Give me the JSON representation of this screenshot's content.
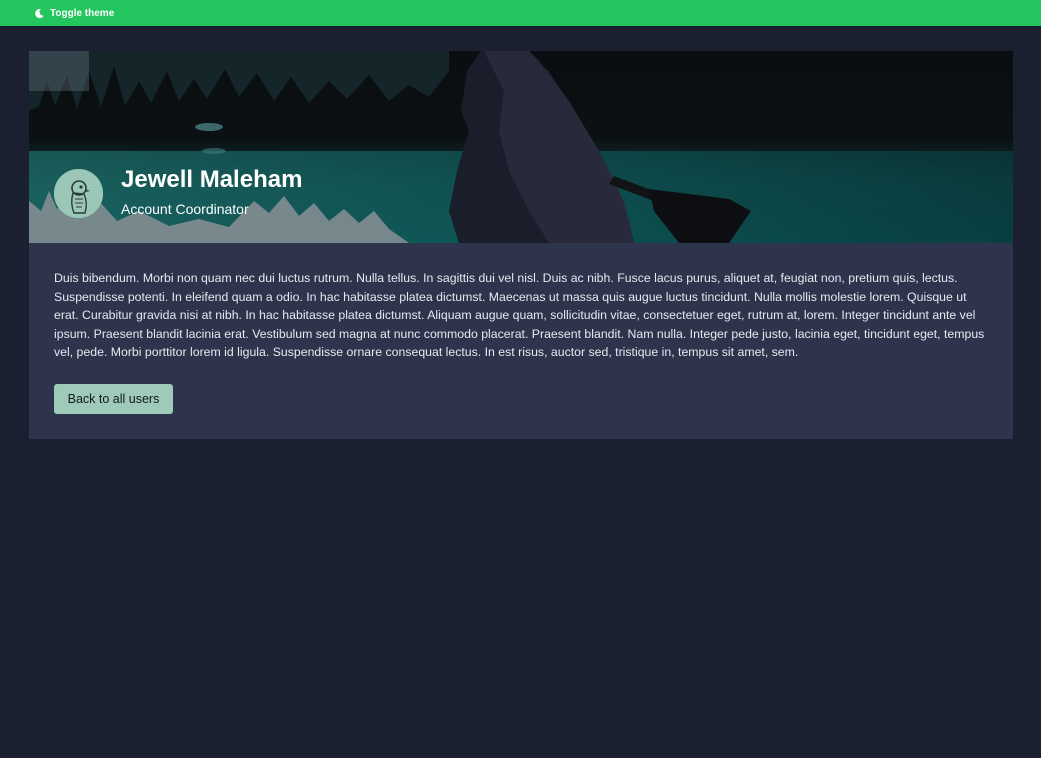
{
  "topbar": {
    "toggle_label": "Toggle theme",
    "bg_color": "#22c55e",
    "icon": "moon-icon"
  },
  "profile": {
    "name": "Jewell Maleham",
    "title": "Account Coordinator",
    "avatar_icon": "bird-avatar-icon",
    "bio": "Duis bibendum. Morbi non quam nec dui luctus rutrum. Nulla tellus. In sagittis dui vel nisl. Duis ac nibh. Fusce lacus purus, aliquet at, feugiat non, pretium quis, lectus. Suspendisse potenti. In eleifend quam a odio. In hac habitasse platea dictumst. Maecenas ut massa quis augue luctus tincidunt. Nulla mollis molestie lorem. Quisque ut erat. Curabitur gravida nisi at nibh. In hac habitasse platea dictumst. Aliquam augue quam, sollicitudin vitae, consectetuer eget, rutrum at, lorem. Integer tincidunt ante vel ipsum. Praesent blandit lacinia erat. Vestibulum sed magna at nunc commodo placerat. Praesent blandit. Nam nulla. Integer pede justo, lacinia eget, tincidunt eget, tempus vel, pede. Morbi porttitor lorem id ligula. Suspendisse ornare consequat lectus. In est risus, auctor sed, tristique in, tempus sit amet, sem.",
    "back_label": "Back to all users"
  },
  "colors": {
    "page_bg": "#1b2030",
    "card_bg": "#2e344c",
    "button_bg": "#9fc9b8"
  }
}
